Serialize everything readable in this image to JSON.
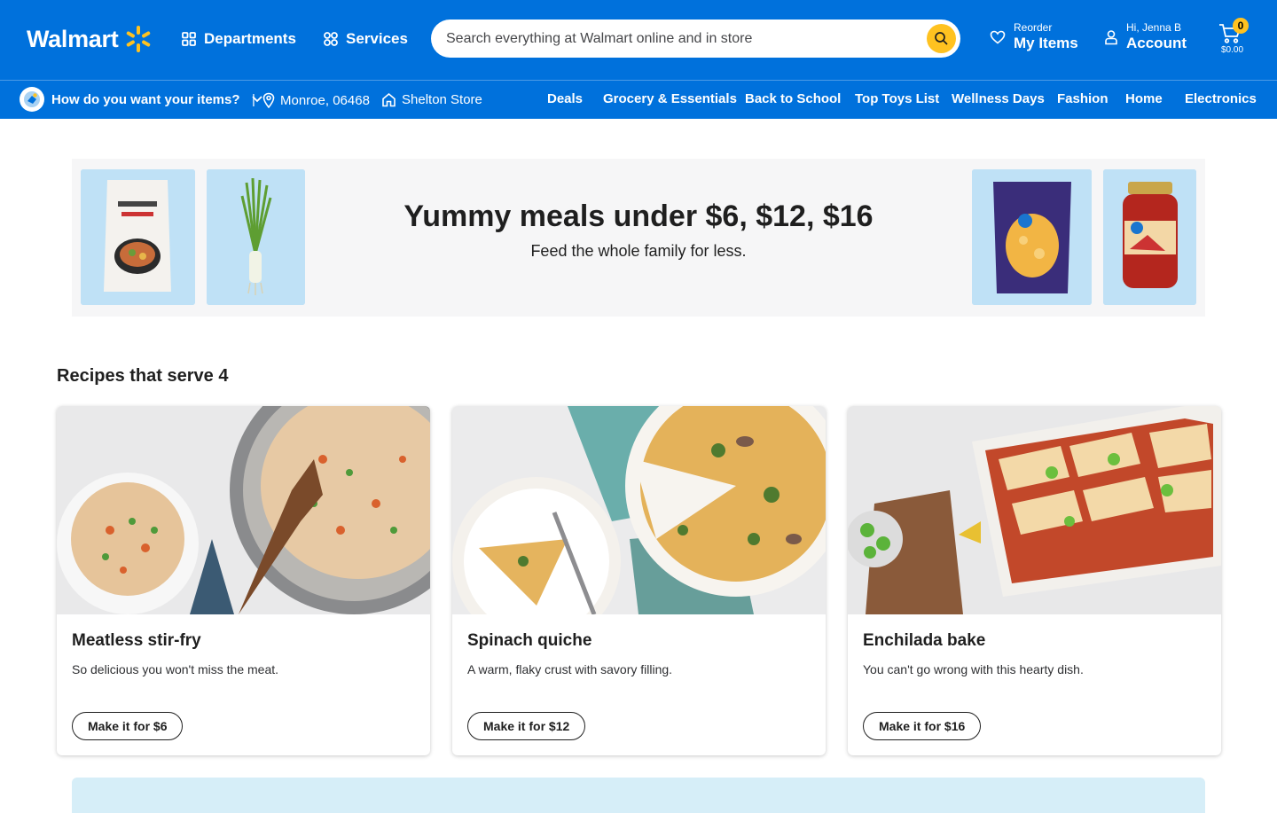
{
  "header": {
    "logo_text": "Walmart",
    "departments_label": "Departments",
    "services_label": "Services",
    "search_placeholder": "Search everything at Walmart online and in store",
    "reorder_small": "Reorder",
    "reorder_big": "My Items",
    "account_small": "Hi, Jenna B",
    "account_big": "Account",
    "cart_count": "0",
    "cart_total": "$0.00"
  },
  "subnav": {
    "fulfillment_label": "How do you want your items?",
    "location": "Monroe, 06468",
    "store": "Shelton Store",
    "separator": "|",
    "categories": [
      "Deals",
      "Grocery & Essentials",
      "Back to School",
      "Top Toys List",
      "Wellness Days",
      "Fashion",
      "Home",
      "Electronics"
    ]
  },
  "banner": {
    "title": "Yummy meals under $6, $12, $16",
    "subtitle": "Feed the whole family for less."
  },
  "recipes": {
    "section_title": "Recipes that serve 4",
    "cards": [
      {
        "title": "Meatless stir-fry",
        "description": "So delicious you won't miss the meat.",
        "button": "Make it for $6"
      },
      {
        "title": "Spinach quiche",
        "description": "A warm, flaky crust with savory filling.",
        "button": "Make it for $12"
      },
      {
        "title": "Enchilada bake",
        "description": "You can't go wrong with this hearty dish.",
        "button": "Make it for $16"
      }
    ]
  },
  "colors": {
    "brand_blue": "#0071dc",
    "spark_yellow": "#ffc220",
    "banner_bg": "#f6f6f7",
    "tile_bg": "#bfe1f6"
  }
}
